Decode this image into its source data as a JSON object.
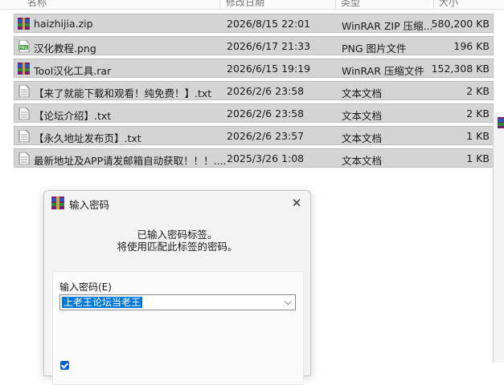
{
  "header": {
    "col_name": "名称",
    "col_date": "修改日期",
    "col_type": "类型",
    "col_size": "大小"
  },
  "files": [
    {
      "name": "haizhijia.zip",
      "date": "2026/8/15 22:01",
      "type": "WinRAR ZIP 压缩...",
      "size": "580,200 KB",
      "icon": "winrar-archive-icon"
    },
    {
      "name": "汉化教程.png",
      "date": "2026/6/17 21:33",
      "type": "PNG 图片文件",
      "size": "196 KB",
      "icon": "png-image-icon"
    },
    {
      "name": "Tool汉化工具.rar",
      "date": "2026/6/15 19:19",
      "type": "WinRAR 压缩文件",
      "size": "152,308 KB",
      "icon": "winrar-archive-icon"
    },
    {
      "name": "【来了就能下载和观看！纯免费！】.txt",
      "date": "2026/2/6 23:58",
      "type": "文本文档",
      "size": "2 KB",
      "icon": "text-file-icon"
    },
    {
      "name": "【论坛介绍】.txt",
      "date": "2026/2/6 23:58",
      "type": "文本文档",
      "size": "2 KB",
      "icon": "text-file-icon"
    },
    {
      "name": "【永久地址发布页】.txt",
      "date": "2026/2/6 23:57",
      "type": "文本文档",
      "size": "1 KB",
      "icon": "text-file-icon"
    },
    {
      "name": "最新地址及APP请发邮箱自动获取！！！....",
      "date": "2025/3/26 1:08",
      "type": "文本文档",
      "size": "1 KB",
      "icon": "text-file-icon"
    }
  ],
  "dialog": {
    "title": "输入密码",
    "message_line1": "已输入密码标签。",
    "message_line2": "将使用匹配此标签的密码。",
    "password_label": "输入密码(E)",
    "password_value": "上老王论坛当老王",
    "close_glyph": "✕",
    "dropdown_glyph": "⌵"
  },
  "colors": {
    "row_selected": "#d4d4d4",
    "accent": "#0078d7"
  }
}
